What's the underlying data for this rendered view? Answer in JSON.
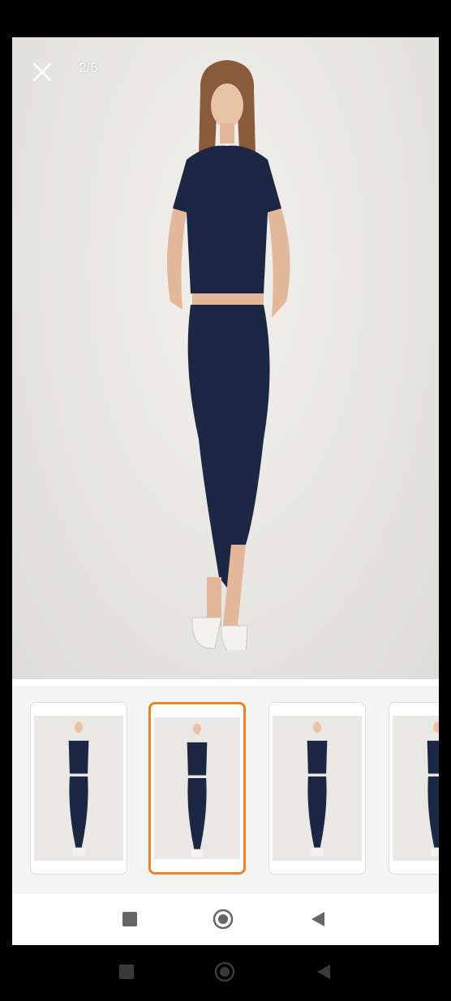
{
  "viewer": {
    "counter": "2/5",
    "close_icon": "close-icon"
  },
  "thumbnails": {
    "selected_index": 1,
    "items": [
      {
        "pose": "front-hands-back"
      },
      {
        "pose": "front-hands-pockets"
      },
      {
        "pose": "front-hand-hair"
      },
      {
        "pose": "front-partial"
      }
    ]
  },
  "colors": {
    "outfit": "#1c2743",
    "selected_border": "#e8822b",
    "background": "#e9e8e5"
  },
  "nav": {
    "recent_icon": "square-icon",
    "home_icon": "circle-home-icon",
    "back_icon": "triangle-back-icon"
  }
}
